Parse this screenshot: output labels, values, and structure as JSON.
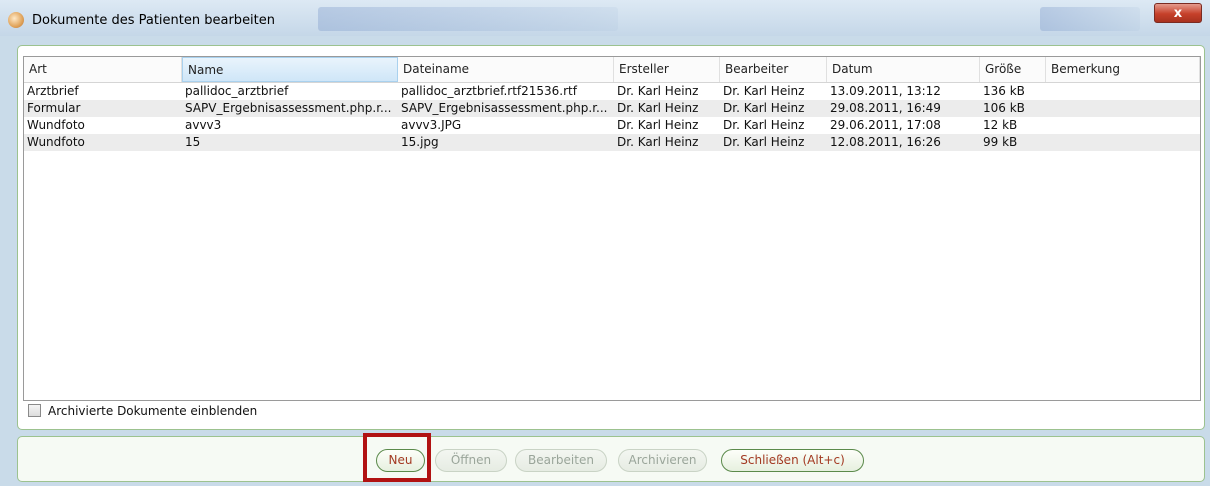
{
  "window": {
    "title": "Dokumente des Patienten bearbeiten",
    "close_label": "x"
  },
  "table": {
    "columns": [
      "Art",
      "Name",
      "Dateiname",
      "Ersteller",
      "Bearbeiter",
      "Datum",
      "Größe",
      "Bemerkung"
    ],
    "rows": [
      [
        "Arztbrief",
        "pallidoc_arztbrief",
        "pallidoc_arztbrief.rtf21536.rtf",
        "Dr. Karl Heinz",
        "Dr. Karl Heinz",
        "13.09.2011, 13:12",
        "136 kB",
        ""
      ],
      [
        "Formular",
        "SAPV_Ergebnisassessment.php.r...",
        "SAPV_Ergebnisassessment.php.r...",
        "Dr. Karl Heinz",
        "Dr. Karl Heinz",
        "29.08.2011, 16:49",
        "106 kB",
        ""
      ],
      [
        "Wundfoto",
        "avvv3",
        "avvv3.JPG",
        "Dr. Karl Heinz",
        "Dr. Karl Heinz",
        "29.06.2011, 17:08",
        "12 kB",
        ""
      ],
      [
        "Wundfoto",
        "15",
        "15.jpg",
        "Dr. Karl Heinz",
        "Dr. Karl Heinz",
        "12.08.2011, 16:26",
        "99 kB",
        ""
      ]
    ]
  },
  "options": {
    "show_archived_label": "Archivierte Dokumente einblenden",
    "show_archived_checked": false
  },
  "buttons": {
    "new": "Neu",
    "open": "Öffnen",
    "edit": "Bearbeiten",
    "archive": "Archivieren",
    "close": "Schließen (Alt+c)"
  },
  "colors": {
    "highlight": "#b11212",
    "panel_border": "#9cc28f",
    "button_text": "#a33a22"
  }
}
